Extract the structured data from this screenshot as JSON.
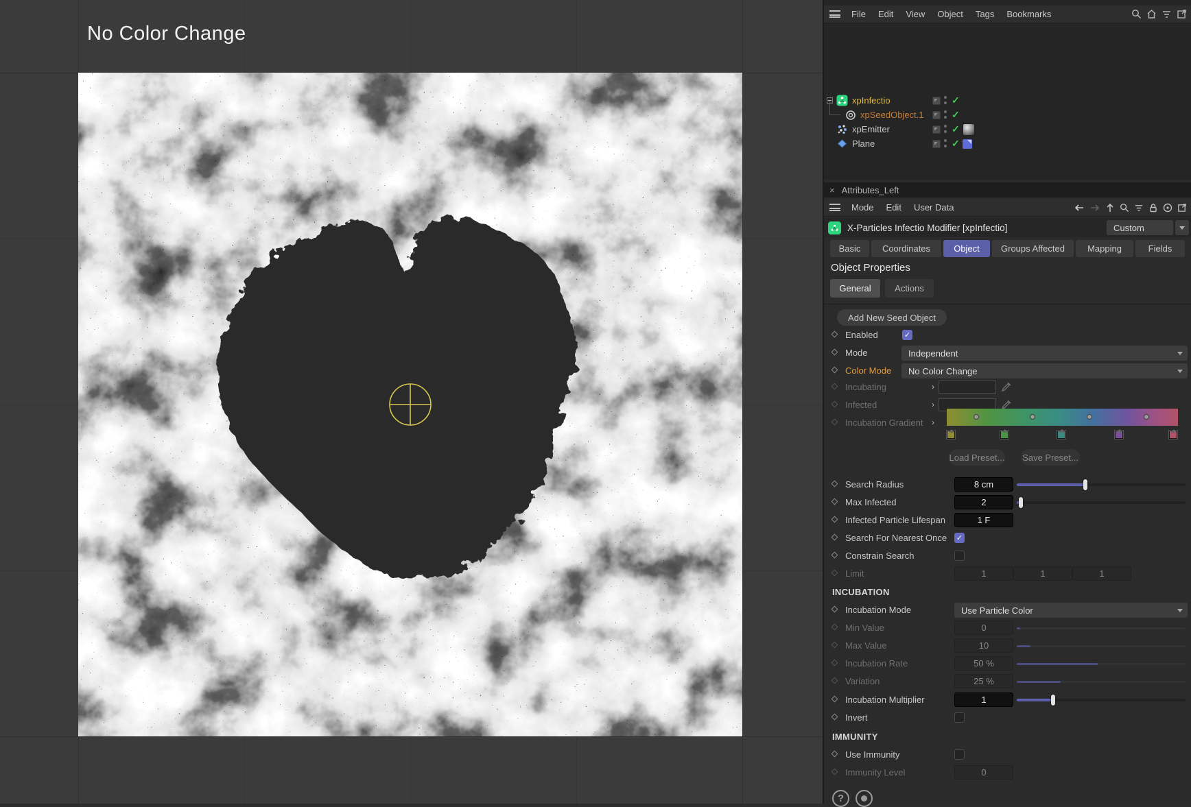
{
  "glyphs": {
    "check": "✓",
    "close": "×",
    "expand": "›",
    "question": "?"
  },
  "viewport": {
    "hud_title": "No Color Change"
  },
  "object_manager": {
    "menus": [
      "File",
      "Edit",
      "View",
      "Object",
      "Tags",
      "Bookmarks"
    ],
    "objects": [
      {
        "name": "xpInfectio",
        "color": "#e2b93b"
      },
      {
        "name": "xpSeedObject.1",
        "color": "#c87c33"
      },
      {
        "name": "xpEmitter",
        "color": "#c8c8c8"
      },
      {
        "name": "Plane",
        "color": "#c8c8c8"
      }
    ]
  },
  "attributes": {
    "panel_title": "Attributes_Left",
    "menus": [
      "Mode",
      "Edit",
      "User Data"
    ],
    "object_title": "X-Particles Infectio Modifier [xpInfectio]",
    "preset_dropdown": "Custom",
    "tabs": [
      {
        "label": "Basic"
      },
      {
        "label": "Coordinates"
      },
      {
        "label": "Object"
      },
      {
        "label": "Groups Affected"
      },
      {
        "label": "Mapping"
      },
      {
        "label": "Fields"
      }
    ],
    "section_title": "Object Properties",
    "subtabs": {
      "general": "General",
      "actions": "Actions"
    },
    "add_seed_button": "Add New Seed Object",
    "params": {
      "enabled": {
        "label": "Enabled",
        "checked": true
      },
      "mode": {
        "label": "Mode",
        "value": "Independent"
      },
      "color_mode": {
        "label": "Color Mode",
        "value": "No Color Change"
      },
      "incubating": {
        "label": "Incubating"
      },
      "infected": {
        "label": "Infected"
      },
      "gradient": {
        "label": "Incubation Gradient",
        "css": "linear-gradient(90deg,#8f8e31 0%,#4f9444 18%,#3f9464 33%,#3a8d84 48%,#44719f 63%,#6f549e 78%,#9b5285 89%,#b25368 100%)",
        "knots": [
          "#8f8d33",
          "#4b9549",
          "#3d8b80",
          "#7b5096",
          "#b05468"
        ],
        "knot_pos": [
          "0px",
          "78px",
          "161px",
          "245px",
          "324px"
        ],
        "dot_pos": [
          "39px",
          "121px",
          "204px",
          "287px"
        ]
      },
      "load_preset": "Load Preset...",
      "save_preset": "Save Preset...",
      "search_radius": {
        "label": "Search Radius",
        "value": "8 cm",
        "fill": "40%",
        "handle": "97px"
      },
      "max_infected": {
        "label": "Max Infected",
        "value": "2",
        "fill": "2%",
        "handle": "3px"
      },
      "lifespan": {
        "label": "Infected Particle Lifespan",
        "value": "1 F"
      },
      "nearest": {
        "label": "Search For Nearest Once",
        "checked": true
      },
      "constrain": {
        "label": "Constrain Search",
        "checked": false
      },
      "limit": {
        "label": "Limit",
        "values": [
          "1",
          "1",
          "1"
        ]
      },
      "incubation_header": "INCUBATION",
      "incubation_mode": {
        "label": "Incubation Mode",
        "value": "Use Particle Color"
      },
      "min_value": {
        "label": "Min Value",
        "value": "0",
        "fill": "2%"
      },
      "max_value": {
        "label": "Max Value",
        "value": "10",
        "fill": "8%"
      },
      "incubation_rate": {
        "label": "Incubation Rate",
        "value": "50 %",
        "fill": "48%"
      },
      "variation": {
        "label": "Variation",
        "value": "25 %",
        "fill": "26%"
      },
      "incubation_multiplier": {
        "label": "Incubation Multiplier",
        "value": "1",
        "fill": "21%",
        "handle": "50px"
      },
      "invert": {
        "label": "Invert",
        "checked": false
      },
      "immunity_header": "IMMUNITY",
      "use_immunity": {
        "label": "Use Immunity",
        "checked": false
      },
      "immunity_level": {
        "label": "Immunity Level",
        "value": "0"
      }
    }
  },
  "colors": {
    "accent": "#5b5fa8",
    "checkbox": "#666ac0",
    "highlight_orange": "#e09a3e",
    "crosshair": "#d8c850",
    "check_green": "#3fcf52"
  }
}
